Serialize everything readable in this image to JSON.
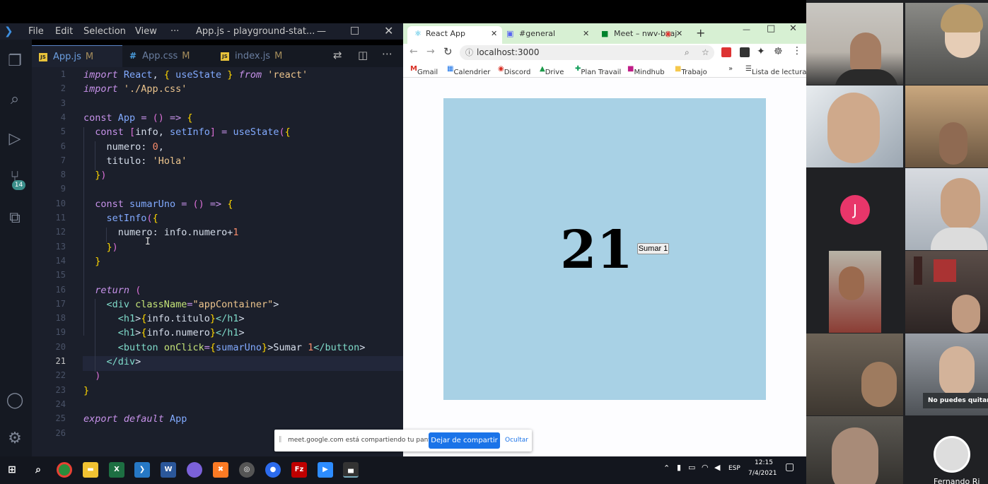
{
  "vscode": {
    "menu": [
      "File",
      "Edit",
      "Selection",
      "View",
      "···"
    ],
    "window_title": "App.js - playground-stat...",
    "source_control_badge": "14",
    "tabs": [
      {
        "name": "App.js",
        "status": "M",
        "type": "js"
      },
      {
        "name": "App.css",
        "status": "M",
        "type": "css"
      },
      {
        "name": "index.js",
        "status": "M",
        "type": "js"
      }
    ],
    "current_line": "21",
    "code_lines": [
      "import React, { useState } from 'react'",
      "import './App.css'",
      "",
      "const App = () => {",
      "  const [info, setInfo] = useState({",
      "    numero: 0,",
      "    titulo: 'Hola'",
      "  })",
      "",
      "  const sumarUno = () => {",
      "    setInfo({",
      "      numero: info.numero+1",
      "    })",
      "  }",
      "",
      "  return (",
      "    <div className=\"appContainer\">",
      "      <h1>{info.titulo}</h1>",
      "      <h1>{info.numero}</h1>",
      "      <button onClick={sumarUno}>Sumar 1</button>",
      "    </div>",
      "  )",
      "}",
      "",
      "export default App",
      ""
    ]
  },
  "chrome": {
    "tabs": [
      {
        "title": "React App",
        "active": true
      },
      {
        "title": "#general",
        "active": false
      },
      {
        "title": "Meet – nwv-bxaj",
        "active": false
      }
    ],
    "url": "localhost:3000",
    "bookmarks": [
      "Gmail",
      "Calendrier",
      "Discord",
      "Drive",
      "Plan Travail",
      "Mindhub",
      "Trabajo",
      "»",
      "Lista de lectura"
    ],
    "page": {
      "h1_number": "21",
      "button_label": "Sumar 1",
      "container_color": "#a8d1e5"
    },
    "share_bar": {
      "message": "meet.google.com está compartiendo tu pantalla.",
      "stop_label": "Dejar de compartir",
      "hide_label": "Ocultar"
    }
  },
  "taskbar": {
    "lang": "ESP",
    "time": "12:15",
    "date": "7/4/2021"
  },
  "meet": {
    "avatar_initial": "J",
    "avatar_color": "#e8366a",
    "toast": "No puedes quitar a",
    "name": "Fernando Ri"
  }
}
